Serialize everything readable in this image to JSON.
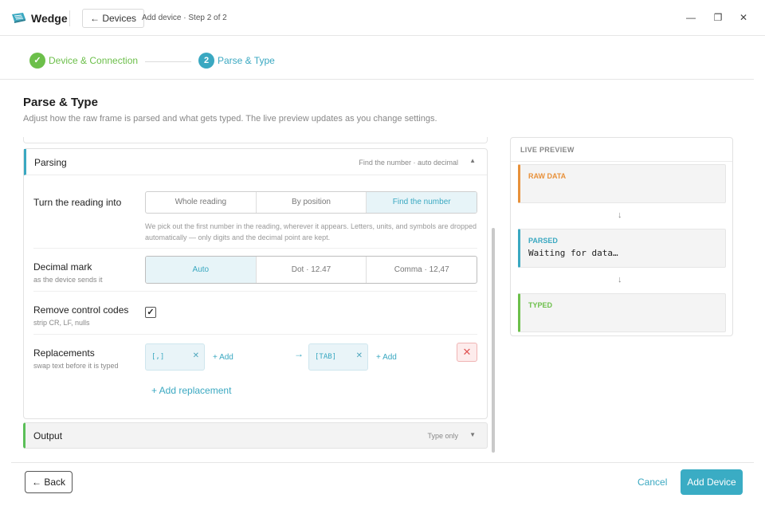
{
  "app": {
    "title": "Wedge",
    "back_label": "← Devices",
    "breadcrumb": "Add device · Step 2 of 2"
  },
  "window": {
    "minimize": "—",
    "maximize": "❐",
    "close": "✕"
  },
  "stepper": {
    "steps": [
      {
        "label": "Device & Connection",
        "marker": "✓",
        "status": "done"
      },
      {
        "label": "Parse & Type",
        "marker": "2",
        "status": "current"
      }
    ]
  },
  "page": {
    "title": "Parse & Type",
    "subtitle": "Adjust how the raw frame is parsed and what gets typed. The live preview updates as you change settings."
  },
  "parsing": {
    "title": "Parsing",
    "summary": "Find the number · auto decimal",
    "chevron": "▲",
    "reading": {
      "label": "Turn the reading into",
      "options": [
        "Whole reading",
        "By position",
        "Find the number"
      ],
      "selected": "Find the number",
      "hint": "We pick out the first number in the reading, wherever it appears. Letters, units, and symbols are dropped automatically — only digits and the decimal point are kept."
    },
    "decimal": {
      "label": "Decimal mark",
      "sub": "as the device sends it",
      "options": [
        "Auto",
        "Dot · 12.47",
        "Comma · 12,47"
      ],
      "selected": "Auto"
    },
    "control_codes": {
      "label": "Remove control codes",
      "sub": "strip CR, LF, nulls",
      "checked": true,
      "check_glyph": "✓"
    },
    "replacements": {
      "label": "Replacements",
      "sub": "swap text before it is typed",
      "from": "[,]",
      "to": "[TAB]",
      "arrow": "→",
      "add_label": "+ Add",
      "remove_glyph": "✕",
      "delete_glyph": "✕",
      "add_replacement": "+ Add replacement"
    }
  },
  "output": {
    "title": "Output",
    "summary": "Type only",
    "chevron": "▼"
  },
  "preview": {
    "title": "LIVE PREVIEW",
    "arrow": "↓",
    "raw": {
      "label": "RAW DATA",
      "value": "",
      "color": "#e8913a"
    },
    "parsed": {
      "label": "PARSED",
      "value": "Waiting for data…",
      "color": "#3aa8c1"
    },
    "typed": {
      "label": "TYPED",
      "value": "",
      "color": "#6cbf4a"
    }
  },
  "footer": {
    "back": "← Back",
    "cancel": "Cancel",
    "add_device": "Add Device"
  },
  "colors": {
    "accent": "#3aa8c1",
    "success": "#6cbf4a",
    "danger": "#e05353",
    "raw": "#e8913a"
  }
}
